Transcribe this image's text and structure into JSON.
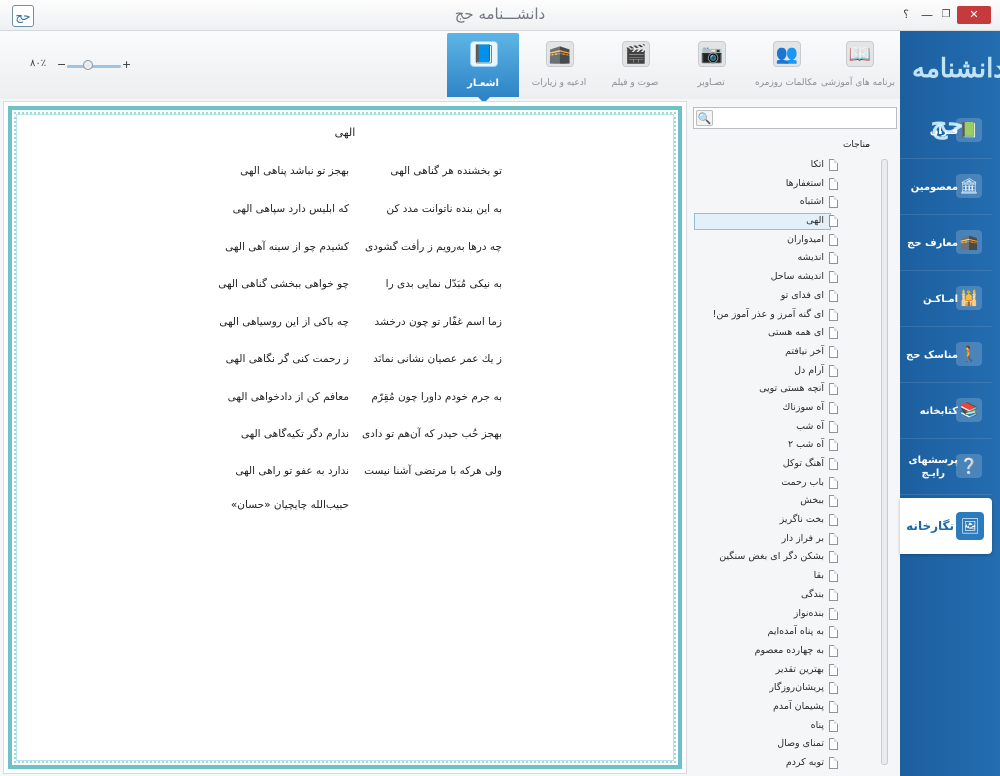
{
  "window": {
    "title": "دانشـــنامه حج",
    "logo_glyph": "حج",
    "help": "؟",
    "minimize": "—",
    "maximize": "❐",
    "close": "✕"
  },
  "toolbar": {
    "tabs": [
      {
        "label": "برنامه های آموزشی",
        "icon": "book-icon",
        "glyph": "📖",
        "active": false
      },
      {
        "label": "مکالمات روزمره",
        "icon": "people-talk-icon",
        "glyph": "👥",
        "active": false
      },
      {
        "label": "تصـاویر",
        "icon": "camera-icon",
        "glyph": "📷",
        "active": false
      },
      {
        "label": "صوت و فیلم",
        "icon": "film-reel-icon",
        "glyph": "🎬",
        "active": false
      },
      {
        "label": "ادعیه و زیارات",
        "icon": "kaaba-icon",
        "glyph": "🕋",
        "active": false
      },
      {
        "label": "اشعـار",
        "icon": "open-book-icon",
        "glyph": "📘",
        "active": true
      }
    ]
  },
  "zoom": {
    "label": "۸۰٪",
    "minus": "−",
    "plus": "+",
    "value_percent": 80
  },
  "poem": {
    "title": "الهی",
    "verses": [
      {
        "first": "تو بخشنده هر گناهی الهی",
        "second": "بهجز تو نباشد پناهی الهی"
      },
      {
        "first": "به این بنده ناتوانت مدد کن",
        "second": "که ابلیس دارد سپاهی الهی"
      },
      {
        "first": "چه درها به‌رویم ز رأفت گشودی",
        "second": "کشیدم چو از سینه آهی الهی"
      },
      {
        "first": "به نیکی مُبَدّل نمایی بدی را",
        "second": "چو خواهی ببخشی گناهی الهی"
      },
      {
        "first": "زما اسم غفّار تو چون درخشد",
        "second": "چه باکی از این روسیاهی الهی"
      },
      {
        "first": "ز یك عمر عصیان نشانی نمانَد",
        "second": "ز رحمت کنی گر نگاهی الهی"
      },
      {
        "first": "به جرم خودم داورا چون مُقِرّم",
        "second": "معافم کن از دادخواهی الهی"
      },
      {
        "first": "بهجز حُب حیدر که آن‌هم تو دادی",
        "second": "ندارم دگر تکیه‌گاهی الهی"
      },
      {
        "first": "ولی هرکه با مرتضی آشنا نیست",
        "second": "ندارد به عفو تو راهی الهی"
      }
    ],
    "author": "حبیب‌الله چایچیان «حسان»"
  },
  "tree": {
    "search_placeholder": "",
    "search_icon": "🔍",
    "root": {
      "label": "مناجات",
      "chevron": "⌄"
    },
    "items": [
      "اتکا",
      "استغفارها",
      "اشتباه",
      "الهی",
      "امیدواران",
      "اندیشه",
      "اندیشه ساحل",
      "ای فدای تو",
      "ای گنه آمرز و عذر آموز من!",
      "ای همه هستی",
      "آخر نیافتم",
      "آرام دل",
      "آنچه هستی تویی",
      "آه سوزناك",
      "آه شب",
      "آه شب ۲",
      "آهنگ توکل",
      "باب رحمت",
      "ببخش",
      "بخت ناگریز",
      "بر فراز دار",
      "بشکن دگر ای بغض سنگین",
      "بقا",
      "بندگی",
      "بنده‌نواز",
      "به پناه آمده‌ایم",
      "به چهارده معصوم",
      "بهترین تقدیر",
      "پریشان‌روزگار",
      "پشیمان آمدم",
      "پناه",
      "تمنای وصال",
      "توبه کردم"
    ],
    "selected_index": 3
  },
  "sidebar": {
    "logo_text": "دانشنامه حج",
    "items": [
      {
        "label": "قـرآن",
        "icon": "quran-icon",
        "glyph": "📗",
        "active": false
      },
      {
        "label": "معصومین",
        "icon": "shrine-icon",
        "glyph": "🏛",
        "active": false
      },
      {
        "label": "معارف حج",
        "icon": "kaaba-book-icon",
        "glyph": "🕋",
        "active": false
      },
      {
        "label": "امـاکـن",
        "icon": "minaret-icon",
        "glyph": "🕌",
        "active": false
      },
      {
        "label": "مناسک حج",
        "icon": "pilgrim-icon",
        "glyph": "🚶",
        "active": false
      },
      {
        "label": "کتابخانه",
        "icon": "books-icon",
        "glyph": "📚",
        "active": false
      },
      {
        "label": "پرسشهای\nرایـج",
        "icon": "question-icon",
        "glyph": "❔",
        "active": false
      },
      {
        "label": "نگارخانه",
        "icon": "gallery-icon",
        "glyph": "🖼",
        "active": true
      }
    ]
  }
}
